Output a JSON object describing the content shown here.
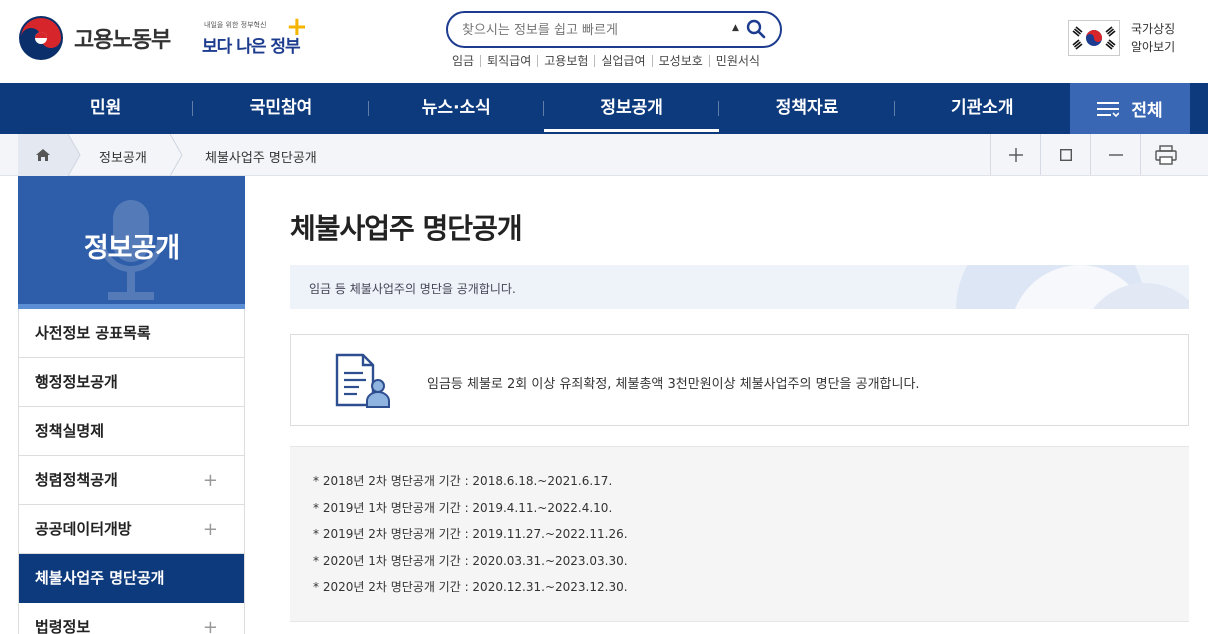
{
  "header": {
    "ministry_name": "고용노동부",
    "slogan_small": "내일을 위한 정부혁신",
    "slogan_big": "보다 나은 정부",
    "search_placeholder": "찾으시는 정보를 쉽고 빠르게",
    "quick_links": [
      "임금",
      "퇴직급여",
      "고용보험",
      "실업급여",
      "모성보호",
      "민원서식"
    ],
    "national_symbol_line1": "국가상징",
    "national_symbol_line2": "알아보기"
  },
  "gnb": {
    "items": [
      "민원",
      "국민참여",
      "뉴스·소식",
      "정보공개",
      "정책자료",
      "기관소개"
    ],
    "active_index": 3,
    "all_label": "전체"
  },
  "breadcrumb": {
    "items": [
      "정보공개",
      "체불사업주 명단공개"
    ]
  },
  "lnb": {
    "title": "정보공개",
    "items": [
      {
        "label": "사전정보 공표목록",
        "expandable": false
      },
      {
        "label": "행정정보공개",
        "expandable": false
      },
      {
        "label": "정책실명제",
        "expandable": false
      },
      {
        "label": "청렴정책공개",
        "expandable": true
      },
      {
        "label": "공공데이터개방",
        "expandable": true
      },
      {
        "label": "체불사업주 명단공개",
        "expandable": false,
        "active": true
      },
      {
        "label": "법령정보",
        "expandable": true
      }
    ],
    "plus_symbol": "+"
  },
  "content": {
    "title": "체불사업주 명단공개",
    "intro": "임금 등 체불사업주의 명단을 공개합니다.",
    "info_text": "임금등 체불로 2회 이상 유죄확정, 체불총액 3천만원이상 체불사업주의 명단을 공개합니다.",
    "periods": [
      "* 2018년 2차 명단공개 기간 : 2018.6.18.~2021.6.17.",
      "* 2019년 1차 명단공개 기간 : 2019.4.11.~2022.4.10.",
      "* 2019년 2차 명단공개 기간 : 2019.11.27.~2022.11.26.",
      "* 2020년 1차 명단공개 기간 : 2020.03.31.~2023.03.30.",
      "* 2020년 2차 명단공개 기간 : 2020.12.31.~2023.12.30."
    ]
  },
  "colors": {
    "navy": "#0d3a7c",
    "lnb_head": "#2e5ea9",
    "all_button": "#3a67b4"
  }
}
